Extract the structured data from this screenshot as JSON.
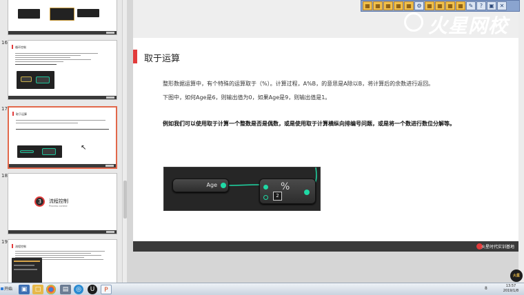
{
  "thumbnails": {
    "slide16": {
      "number": "16",
      "title": "循环控制 "
    },
    "slide17": {
      "number": "17",
      "title": "取于运算"
    },
    "slide18": {
      "number": "18",
      "title": "流程控制",
      "subtitle": "Process control",
      "section_num": "3"
    },
    "slide19": {
      "number": "19",
      "title": "流程控制"
    }
  },
  "slide": {
    "brand": "火星网校",
    "title": "取于运算",
    "para1": "整形数据运算中，有个特殊的运算取于（%）。计算过程，A%B，的意思是A除以B，将计算后的余数进行返回。",
    "para2": "下图中，如何Age是6，则输出值为0，如果Age是9，则输出值是1。",
    "para3": "例如我们可以使用取于计算一个整数是否是偶数，或是使用取于计算横纵向排编号问题，或是将一个数进行数位分解等。",
    "footer_brand": "火星时代实训基地",
    "blueprint": {
      "var_name": "Age",
      "operator": "%",
      "divisor": "2"
    }
  },
  "toolbar": {
    "icons": [
      "grid-icon",
      "grid-icon",
      "grid-icon",
      "grid-icon",
      "grid-icon",
      "settings-icon",
      "grid-icon",
      "grid-icon",
      "grid-icon",
      "grid-icon",
      "pen-icon",
      "help-icon",
      "display-icon",
      "close-icon"
    ]
  },
  "badge": "火星JOY",
  "taskbar": {
    "start_label": "开始",
    "tray_indicator": "8",
    "time": "13:57",
    "date": "2019/1/8"
  }
}
